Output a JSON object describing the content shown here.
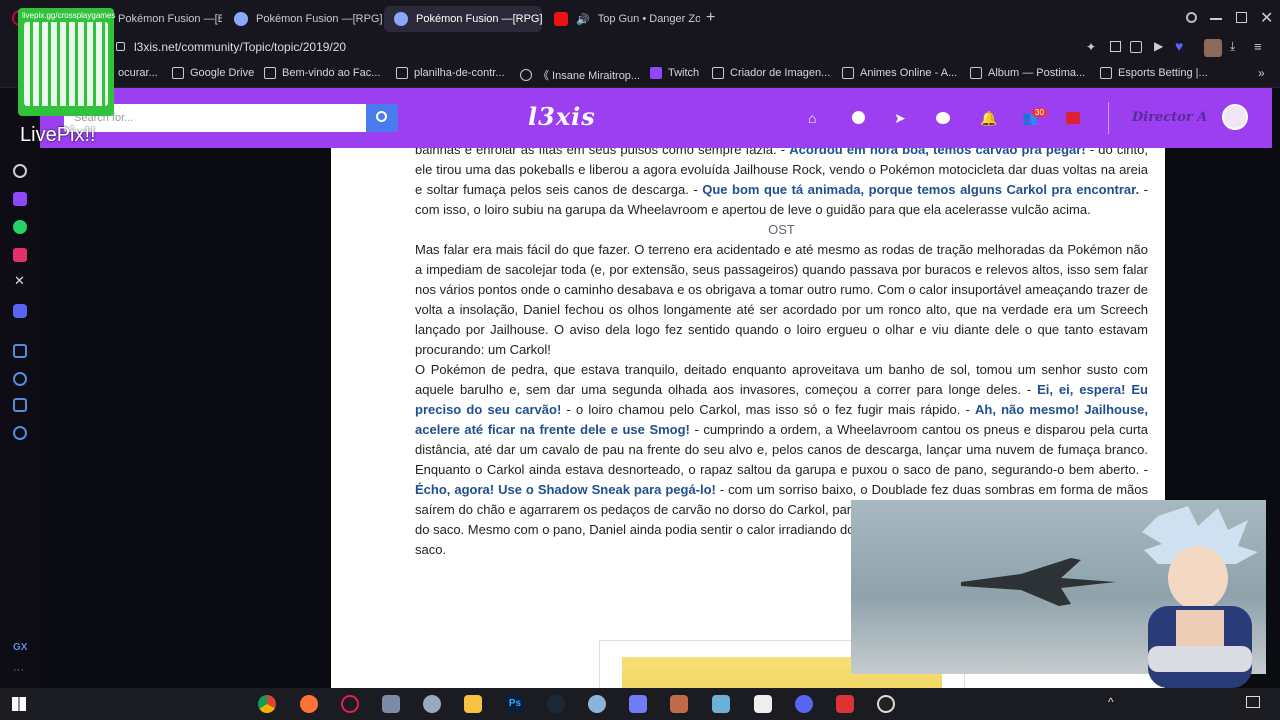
{
  "browser": {
    "tabs": [
      {
        "label": "Pokémon Fusion —[Battle",
        "active": false
      },
      {
        "label": "Pokémon Fusion —[RPG]",
        "active": false
      },
      {
        "label": "Pokémon Fusion —[RPG]",
        "active": true
      },
      {
        "label": "Top Gun • Danger Zon",
        "active": false
      }
    ],
    "url": "l3xis.net/community/Topic/topic/2019/20",
    "bookmarks": [
      "ocurar...",
      "Google Drive",
      "Bem-vindo ao Fac...",
      "planilha-de-contr...",
      "《 Insane Miraitrop...",
      "Twitch",
      "Criador de Imagen...",
      "Animes Online - A...",
      "Album — Postima...",
      "Esports Betting |..."
    ]
  },
  "overlay": {
    "qr_caption": "livepix.gg/crossplaygames",
    "livepix_label": "LivePix!!"
  },
  "site": {
    "search_placeholder": "Search for...",
    "logo": "l3xis",
    "notif_count": "30",
    "username": "Director A",
    "colors": {
      "header": "#9b3ff0",
      "dialogue": "#1f4f8f",
      "search_button": "#4a7cf0"
    }
  },
  "article": {
    "p1_text1": "bainhas e enrolar as fitas em seus pulsos como sempre fazia. - ",
    "p1_speech1": "Acordou em hora boa, temos carvão pra pegar!",
    "p1_text2": " - do cinto, ele tirou uma das pokeballs e liberou a agora evoluída Jailhouse Rock, vendo o Pokémon motocicleta dar duas voltas na areia e soltar fumaça pelos seis canos de descarga. - ",
    "p1_speech2": "Que bom que tá animada, porque temos alguns Carkol pra encontrar.",
    "p1_text3": " - com isso, o loiro subiu na garupa da Wheelavroom e apertou de leve o guidão para que ela acelerasse vulcão acima.",
    "ost_label": "OST",
    "p2": "Mas falar era mais fácil do que fazer. O terreno era acidentado e até mesmo as rodas de tração melhoradas da Pokémon não a impediam de sacolejar toda (e, por extensão, seus passageiros) quando passava por buracos e relevos altos, isso sem falar nos vários pontos onde o caminho desabava e os obrigava a tomar outro rumo. Com o calor insuportável ameaçando trazer de volta a insolação, Daniel fechou os olhos longamente até ser acordado por um ronco alto, que na verdade era um Screech lançado por Jailhouse. O aviso dela logo fez sentido quando o loiro ergueu o olhar e viu diante dele o que tanto estavam procurando: um Carkol!",
    "p3_text1": "O Pokémon de pedra, que estava tranquilo, deitado enquanto aproveitava um banho de sol, tomou um senhor susto com aquele barulho e, sem dar uma segunda olhada aos invasores, começou a correr para longe deles. - ",
    "p3_speech1": "Ei, ei, espera! Eu preciso do seu carvão!",
    "p3_text2": " - o loiro chamou pelo Carkol, mas isso só o fez fugir mais rápido. - ",
    "p3_speech2": "Ah, não mesmo! Jailhouse, acelere até ficar na frente dele e use Smog!",
    "p3_text3": " - cumprindo a ordem, a Wheelavroom cantou os pneus e disparou pela curta distância, até dar um cavalo de pau na frente do seu alvo e, pelos canos de descarga, lançar uma nuvem de fumaça branco. Enquanto o Carkol ainda estava desnorteado, o rapaz saltou da garupa e puxou o saco de pano, segurando-o bem aberto. - ",
    "p3_speech3": "Écho, agora! Use o Shadow Sneak para pegá-lo!",
    "p3_text4": " - com um sorriso baixo, o Doublade fez duas sombras em forma de mãos saírem do chão e agarrarem os pedaços de carvão no dorso do Carkol, para depois puxá-las de volta e jogar as pedras dentro do saco. Mesmo com o pano, Daniel ainda podia sentir o calor irradiando dos carvões enquanto amarrava com força a boca do saco."
  }
}
